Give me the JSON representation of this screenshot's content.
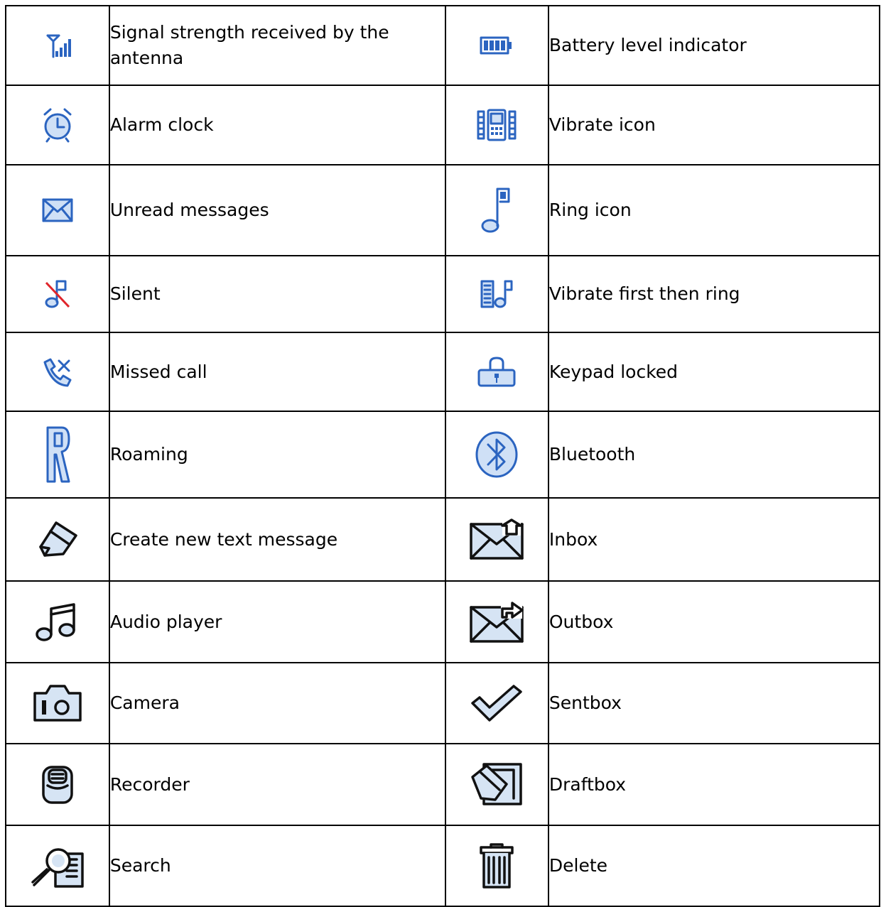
{
  "rows": [
    {
      "left": {
        "icon": "signal-strength-icon",
        "label": "Signal strength received by the antenna"
      },
      "right": {
        "icon": "battery-icon",
        "label": "Battery level indicator"
      }
    },
    {
      "left": {
        "icon": "alarm-clock-icon",
        "label": "Alarm clock"
      },
      "right": {
        "icon": "vibrate-icon",
        "label": "Vibrate icon"
      }
    },
    {
      "left": {
        "icon": "envelope-icon",
        "label": "Unread messages"
      },
      "right": {
        "icon": "music-note-icon",
        "label": "Ring icon"
      }
    },
    {
      "left": {
        "icon": "silent-icon",
        "label": "Silent"
      },
      "right": {
        "icon": "vibrate-ring-icon",
        "label": "Vibrate first then ring"
      }
    },
    {
      "left": {
        "icon": "missed-call-icon",
        "label": "Missed call"
      },
      "right": {
        "icon": "padlock-icon",
        "label": "Keypad locked"
      }
    },
    {
      "left": {
        "icon": "roaming-icon",
        "label": "Roaming"
      },
      "right": {
        "icon": "bluetooth-icon",
        "label": "Bluetooth"
      }
    },
    {
      "left": {
        "icon": "pencil-message-icon",
        "label": "Create new text message"
      },
      "right": {
        "icon": "inbox-icon",
        "label": "Inbox"
      }
    },
    {
      "left": {
        "icon": "audio-player-icon",
        "label": "Audio player"
      },
      "right": {
        "icon": "outbox-icon",
        "label": "Outbox"
      }
    },
    {
      "left": {
        "icon": "camera-icon",
        "label": "Camera"
      },
      "right": {
        "icon": "checkmark-icon",
        "label": "Sentbox"
      }
    },
    {
      "left": {
        "icon": "recorder-icon",
        "label": "Recorder"
      },
      "right": {
        "icon": "draftbox-icon",
        "label": "Draftbox"
      }
    },
    {
      "left": {
        "icon": "search-icon",
        "label": "Search"
      },
      "right": {
        "icon": "trash-icon",
        "label": "Delete"
      }
    }
  ],
  "colors": {
    "status_icon_blue": "#2b64c0",
    "menu_icon_black": "#111111",
    "border": "#000000"
  }
}
